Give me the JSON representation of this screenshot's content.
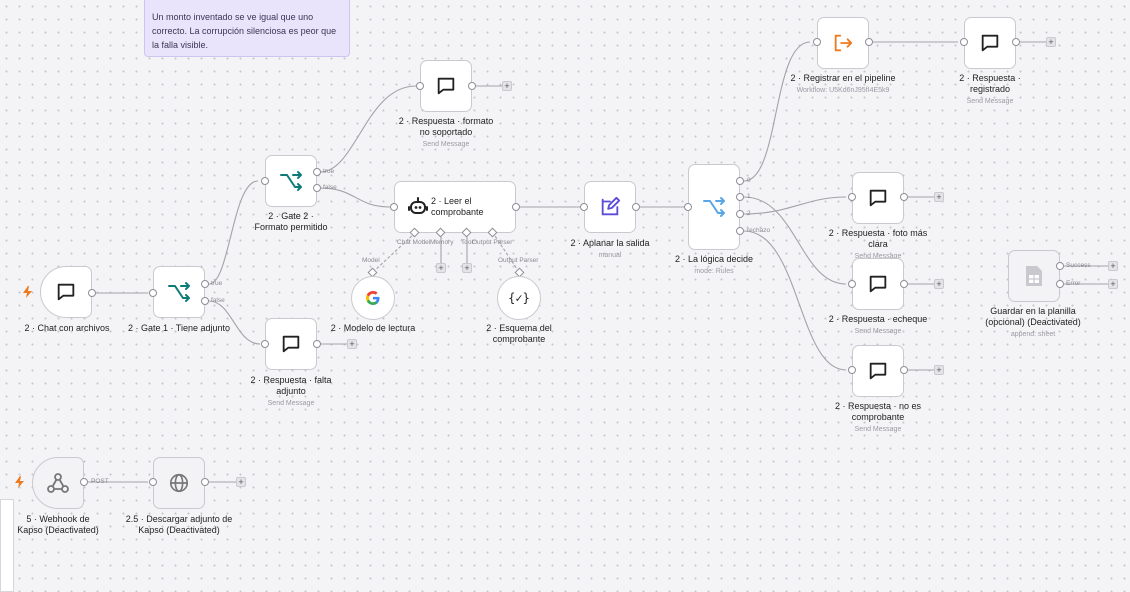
{
  "sticky_note": {
    "text": "Un monto inventado se ve igual que uno correcto. La corrupción silenciosa es peor que la falla visible."
  },
  "nodes": {
    "chat_con_archivos": {
      "label": "2 · Chat con archivos"
    },
    "gate1": {
      "label": "2 · Gate 1 · Tiene adjunto"
    },
    "gate2": {
      "label": "2 · Gate 2 · Formato permitido"
    },
    "resp_formato": {
      "label": "2 · Respuesta · formato no soportado",
      "sub": "Send Message"
    },
    "resp_falta": {
      "label": "2 · Respuesta · falta adjunto",
      "sub": "Send Message"
    },
    "leer": {
      "label": "2 · Leer el comprobante"
    },
    "modelo": {
      "label": "2 · Modelo de lectura"
    },
    "esquema": {
      "label": "2 · Esquema del comprobante"
    },
    "aplanar": {
      "label": "2 · Aplanar la salida",
      "sub": "manual"
    },
    "logica": {
      "label": "2 · La lógica decide",
      "sub": "mode: Rules"
    },
    "registrar": {
      "label": "2 · Registrar en el pipeline",
      "sub": "Workflow: U5Kd6nJ95fI4E5k9"
    },
    "resp_registrado": {
      "label": "2 · Respuesta · registrado",
      "sub": "Send Message"
    },
    "resp_foto": {
      "label": "2 · Respuesta · foto más clara",
      "sub": "Send Message"
    },
    "resp_echeque": {
      "label": "2 · Respuesta · echeque",
      "sub": "Send Message"
    },
    "resp_no_es": {
      "label": "2 · Respuesta · no es comprobante",
      "sub": "Send Message"
    },
    "guardar": {
      "label": "Guardar en la planilla (opcional) (Deactivated)",
      "sub": "append: sheet"
    },
    "webhook": {
      "label": "5 · Webhook de Kapso (Deactivated)"
    },
    "descargar": {
      "label": "2.5 · Descargar adjunto de Kapso (Deactivated)"
    }
  },
  "ports": {
    "true": "true",
    "false": "false",
    "post": "POST",
    "r0": "0",
    "r1": "1",
    "r2": "2",
    "rechazo": "rechazo",
    "success": "Success",
    "error": "Error",
    "chat_model": "Chat Model",
    "memory": "Memory",
    "tool": "Tool",
    "output_parser": "Output Parser",
    "model": "Model",
    "output_parser2": "Output Parser"
  },
  "colors": {
    "teal": "#0f7a7a",
    "orange": "#ee7a1f",
    "purple": "#5b4bd8",
    "blue": "#5aa5e6",
    "edge": "#9c9ca3"
  },
  "icons": [
    "chat-bubble-icon",
    "switch-icon",
    "robot-icon",
    "google-icon",
    "code-braces-icon",
    "pen-edit-icon",
    "exit-arrow-icon",
    "spreadsheet-icon",
    "webhook-icon",
    "globe-icon",
    "lightning-icon"
  ]
}
